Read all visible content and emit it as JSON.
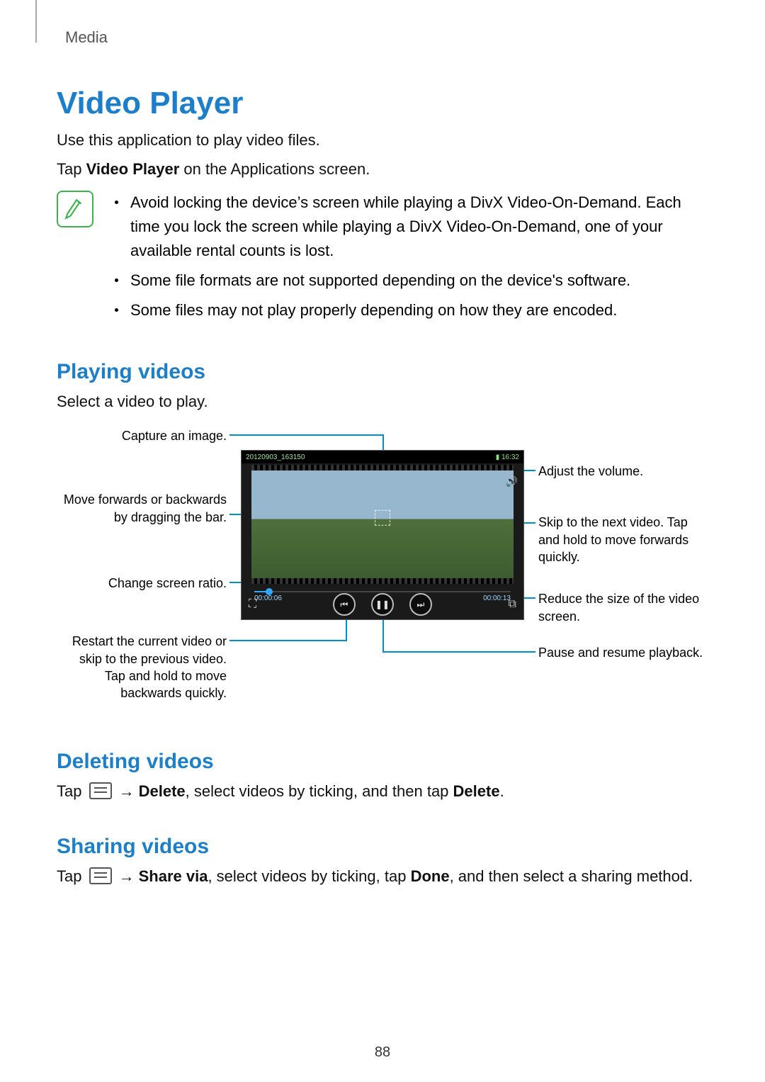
{
  "breadcrumb": "Media",
  "title": "Video Player",
  "intro1": "Use this application to play video files.",
  "intro_tap_pre": "Tap ",
  "intro_tap_bold": "Video Player",
  "intro_tap_post": " on the Applications screen.",
  "notes": {
    "n0": "Avoid locking the device’s screen while playing a DivX Video-On-Demand. Each time you lock the screen while playing a DivX Video-On-Demand, one of your available rental counts is lost.",
    "n1": "Some file formats are not supported depending on the device's software.",
    "n2": "Some files may not play properly depending on how they are encoded."
  },
  "sections": {
    "playing": "Playing videos",
    "playing_sub": "Select a video to play.",
    "deleting": "Deleting videos",
    "sharing": "Sharing videos"
  },
  "callouts": {
    "capture": "Capture an image.",
    "drag": "Move forwards or backwards by dragging the bar.",
    "ratio": "Change screen ratio.",
    "restart": "Restart the current video or skip to the previous video. Tap and hold to move backwards quickly.",
    "volume": "Adjust the volume.",
    "next": "Skip to the next video. Tap and hold to move forwards quickly.",
    "reduce": "Reduce the size of the video screen.",
    "pause": "Pause and resume playback."
  },
  "player": {
    "filename": "20120903_163150",
    "clock": "16:32",
    "time_elapsed": "00:00:06",
    "time_total": "00:00:13"
  },
  "del": {
    "tap": "Tap ",
    "arrow": "→",
    "bold1": "Delete",
    "mid": ", select videos by ticking, and then tap ",
    "bold2": "Delete",
    "end": "."
  },
  "share": {
    "tap": "Tap ",
    "arrow": "→",
    "bold1": "Share via",
    "mid": ", select videos by ticking, tap ",
    "bold2": "Done",
    "end": ", and then select a sharing method."
  },
  "page_number": "88"
}
